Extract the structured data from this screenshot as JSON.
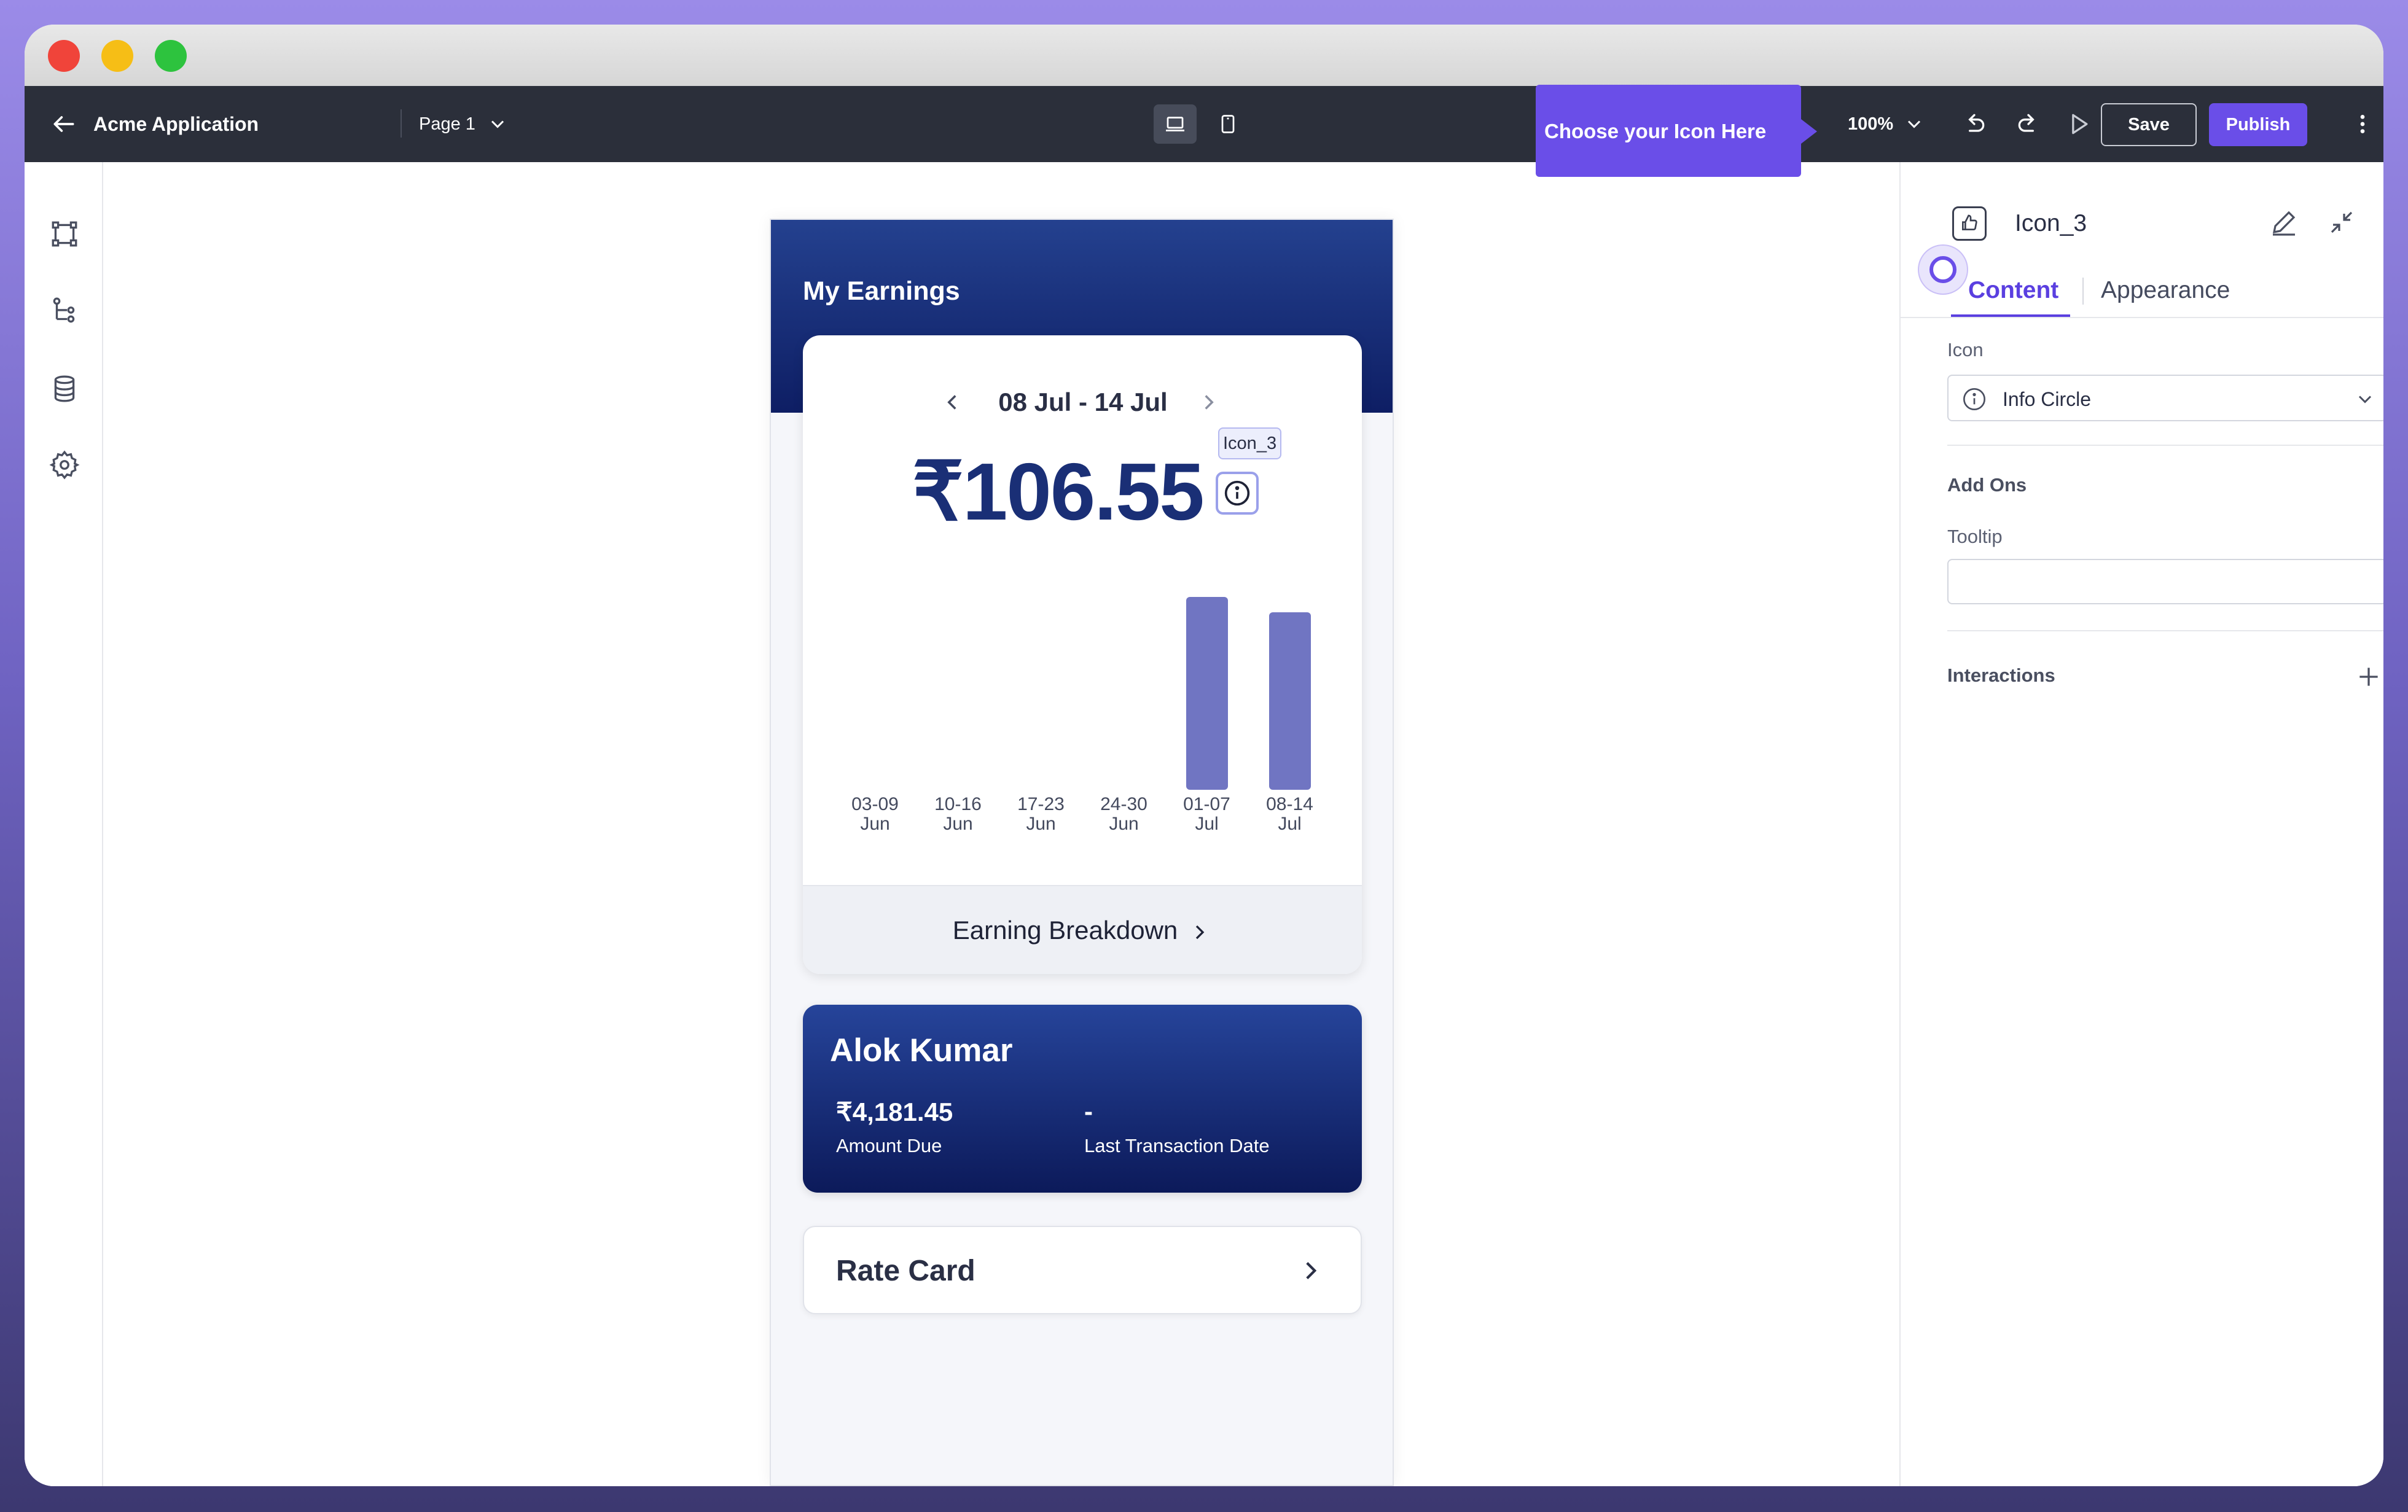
{
  "toolbar": {
    "app_name": "Acme Application",
    "page_selector": "Page 1",
    "zoom": "100%",
    "save_label": "Save",
    "publish_label": "Publish"
  },
  "preview": {
    "header_title": "My Earnings",
    "date_range": "08 Jul - 14 Jul",
    "amount": "₹106.55",
    "selected_component_tag": "Icon_3",
    "chart_data": {
      "type": "bar",
      "categories": [
        [
          "03-09",
          "Jun"
        ],
        [
          "10-16",
          "Jun"
        ],
        [
          "17-23",
          "Jun"
        ],
        [
          "24-30",
          "Jun"
        ],
        [
          "01-07",
          "Jul"
        ],
        [
          "08-14",
          "Jul"
        ]
      ],
      "values": [
        0,
        0,
        0,
        0,
        1.0,
        0.92
      ]
    },
    "breakdown_link": "Earning Breakdown",
    "user_card": {
      "name": "Alok Kumar",
      "amount_due_value": "₹4,181.45",
      "amount_due_label": "Amount Due",
      "last_txn_value": "-",
      "last_txn_label": "Last Transaction Date"
    },
    "rate_card_label": "Rate Card"
  },
  "callout": {
    "text": "Choose your Icon Here"
  },
  "panel": {
    "component_name": "Icon_3",
    "tabs": {
      "content": "Content",
      "appearance": "Appearance"
    },
    "icon_field_label": "Icon",
    "icon_value": "Info Circle",
    "addons_label": "Add Ons",
    "tooltip_label": "Tooltip",
    "tooltip_value": "",
    "interactions_label": "Interactions"
  },
  "colors": {
    "accent": "#6a4ee8",
    "toolbar_bg": "#2b2f3a",
    "header_gradient_top": "#24418f",
    "header_gradient_bottom": "#0e1e64",
    "bar": "#7075c2"
  }
}
